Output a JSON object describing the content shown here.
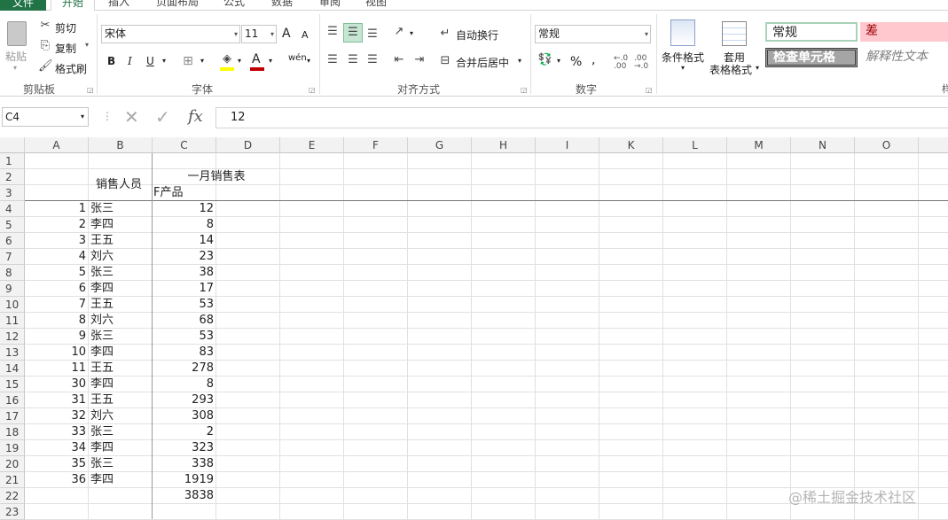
{
  "tabs": {
    "file": "文件",
    "home": "开始",
    "insert": "插入",
    "layout": "页面布局",
    "formulas": "公式",
    "data": "数据",
    "review": "审阅",
    "view": "视图"
  },
  "clipboard": {
    "paste": "粘贴",
    "cut": "剪切",
    "copy": "复制",
    "format_painter": "格式刷",
    "group_label": "剪贴板"
  },
  "font": {
    "name": "宋体",
    "size": "11",
    "group_label": "字体",
    "bold": "B",
    "italic": "I",
    "underline": "U",
    "grow": "A",
    "shrink": "A",
    "font_color_label": "A",
    "phonetic": "wén"
  },
  "alignment": {
    "wrap_text": "自动换行",
    "merge_center": "合并后居中",
    "group_label": "对齐方式"
  },
  "number": {
    "format": "常规",
    "group_label": "数字",
    "percent": "%",
    "comma": ",",
    "inc_dec": "←.0 .00",
    "dec_dec": ".00 →.0"
  },
  "styles": {
    "conditional": "条件格式",
    "table_format_1": "套用",
    "table_format_2": "表格格式",
    "normal": "常规",
    "bad": "差",
    "check_cell": "检查单元格",
    "explanatory": "解释性文本"
  },
  "formula_bar": {
    "cell_ref": "C4",
    "fx": "fx",
    "value": "12"
  },
  "columns": [
    "A",
    "B",
    "C",
    "D",
    "E",
    "F",
    "G",
    "H",
    "I",
    "K",
    "L",
    "M",
    "N",
    "O"
  ],
  "rows": [
    "1",
    "2",
    "3",
    "4",
    "5",
    "6",
    "7",
    "8",
    "9",
    "10",
    "11",
    "12",
    "13",
    "14",
    "15",
    "16",
    "17",
    "18",
    "19",
    "20",
    "21",
    "22",
    "23"
  ],
  "sheet": {
    "title": "一月销售表",
    "header_person": "销售人员",
    "header_product": "F产品",
    "records": [
      {
        "id": "1",
        "name": "张三",
        "value": "12"
      },
      {
        "id": "2",
        "name": "李四",
        "value": "8"
      },
      {
        "id": "3",
        "name": "王五",
        "value": "14"
      },
      {
        "id": "4",
        "name": "刘六",
        "value": "23"
      },
      {
        "id": "5",
        "name": "张三",
        "value": "38"
      },
      {
        "id": "6",
        "name": "李四",
        "value": "17"
      },
      {
        "id": "7",
        "name": "王五",
        "value": "53"
      },
      {
        "id": "8",
        "name": "刘六",
        "value": "68"
      },
      {
        "id": "9",
        "name": "张三",
        "value": "53"
      },
      {
        "id": "10",
        "name": "李四",
        "value": "83"
      },
      {
        "id": "11",
        "name": "王五",
        "value": "278"
      },
      {
        "id": "30",
        "name": "李四",
        "value": "8"
      },
      {
        "id": "31",
        "name": "王五",
        "value": "293"
      },
      {
        "id": "32",
        "name": "刘六",
        "value": "308"
      },
      {
        "id": "33",
        "name": "张三",
        "value": "2"
      },
      {
        "id": "34",
        "name": "李四",
        "value": "323"
      },
      {
        "id": "35",
        "name": "张三",
        "value": "338"
      },
      {
        "id": "36",
        "name": "李四",
        "value": "1919"
      }
    ],
    "total": "3838"
  },
  "watermark": "@稀土掘金技术社区",
  "colors": {
    "accent": "#217346",
    "bad_fill": "#ffc7ce",
    "bad_text": "#9c0006",
    "check_fill": "#a5a5a5",
    "normal_border": "#a9d3b8"
  }
}
